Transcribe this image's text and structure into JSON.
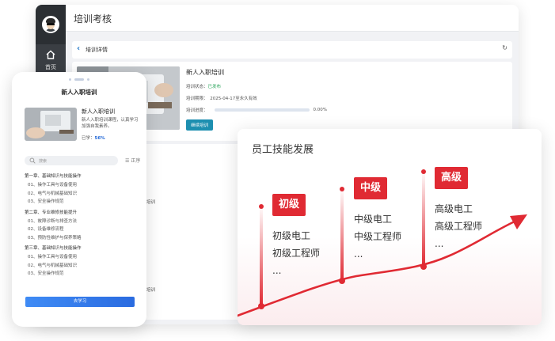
{
  "desktop": {
    "page_title": "培训考核",
    "nav_home": "首页",
    "breadcrumb": "培训详情",
    "course": {
      "title": "新人入职培训",
      "status_label": "培训状态：",
      "status_value": "已发布",
      "period": "培训期限：　2025-04-17至永久有效",
      "progress_label": "培训进度：",
      "progress_value": "0.00%",
      "progress_fraction": 0.0,
      "continue_button": "继续培训"
    },
    "lower_text_1": "培训",
    "lower_text_2": "培训"
  },
  "mobile": {
    "title": "新人入职培训",
    "course_title": "新人入职培训",
    "course_desc": "新人入职培训课程，认真学习加强自我素养。",
    "done_label": "已学：",
    "done_value": "56%",
    "search_placeholder": "搜索",
    "order_label": "正序",
    "chapters": [
      {
        "title": "第一章、基础知识与技能操作",
        "items": [
          "01、操作工具与设备使用",
          "02、电气与机械基础知识",
          "03、安全操作规范"
        ]
      },
      {
        "title": "第二章、专业维修技能提升",
        "items": [
          "01、故障诊断与排查方法",
          "02、设备维修流程",
          "03、预防性维护与保养策略"
        ]
      },
      {
        "title": "第三章、基础知识与技能操作",
        "items": [
          "01、操作工具与设备使用",
          "02、电气与机械基础知识",
          "03、安全操作规范"
        ]
      }
    ],
    "study_button": "去学习"
  },
  "skills": {
    "title": "员工技能发展",
    "accent_color": "#e02a33",
    "levels": [
      {
        "badge": "初级",
        "roles": [
          "初级电工",
          "初级工程师",
          "..."
        ]
      },
      {
        "badge": "中级",
        "roles": [
          "中级电工",
          "中级工程师",
          "..."
        ]
      },
      {
        "badge": "高级",
        "roles": [
          "高级电工",
          "高级工程师",
          "..."
        ]
      }
    ]
  }
}
